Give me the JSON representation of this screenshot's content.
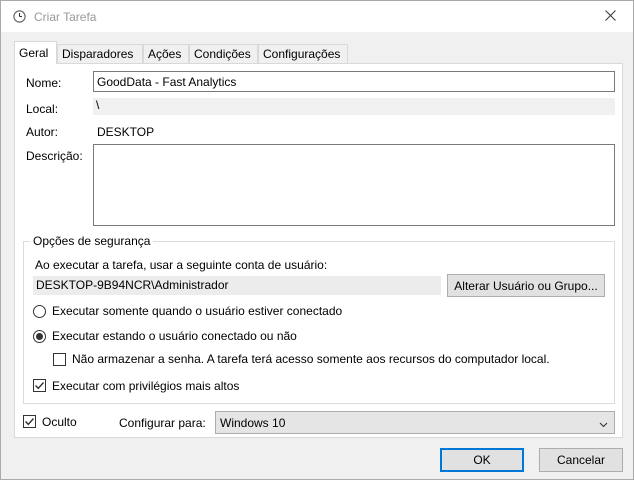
{
  "window": {
    "title": "Criar Tarefa",
    "close_glyph": "✕"
  },
  "tabs": [
    {
      "label": "Geral",
      "active": true
    },
    {
      "label": "Disparadores",
      "active": false
    },
    {
      "label": "Ações",
      "active": false
    },
    {
      "label": "Condições",
      "active": false
    },
    {
      "label": "Configurações",
      "active": false
    }
  ],
  "general": {
    "name_label": "Nome:",
    "name_value": "GoodData - Fast Analytics",
    "location_label": "Local:",
    "location_value": "\\",
    "author_label": "Autor:",
    "author_value": "DESKTOP",
    "description_label": "Descrição:",
    "description_value": ""
  },
  "security": {
    "group_title": "Opções de segurança",
    "run_as_label": "Ao executar a tarefa, usar a seguinte conta de usuário:",
    "account_value": "DESKTOP-9B94NCR\\Administrador",
    "change_user_button": "Alterar Usuário ou Grupo...",
    "radio_logged_on": "Executar somente quando o usuário estiver conectado",
    "radio_logged_on_checked": false,
    "radio_whether": "Executar estando o usuário conectado ou não",
    "radio_whether_checked": true,
    "no_store_password": "Não armazenar a senha. A tarefa terá acesso somente aos recursos do computador local.",
    "no_store_password_checked": false,
    "highest_privileges": "Executar com privilégios mais altos",
    "highest_privileges_checked": true
  },
  "bottom": {
    "hidden_label": "Oculto",
    "hidden_checked": true,
    "configure_for_label": "Configurar para:",
    "configure_for_value": "Windows 10"
  },
  "buttons": {
    "ok": "OK",
    "cancel": "Cancelar"
  },
  "icons": {
    "title": "clock-icon",
    "close": "close-icon",
    "dropdown": "chevron-down-icon",
    "check": "checkmark-icon"
  },
  "colors": {
    "accent": "#0078d7",
    "window_bg": "#f0f0f0",
    "panel_bg": "#ffffff"
  }
}
